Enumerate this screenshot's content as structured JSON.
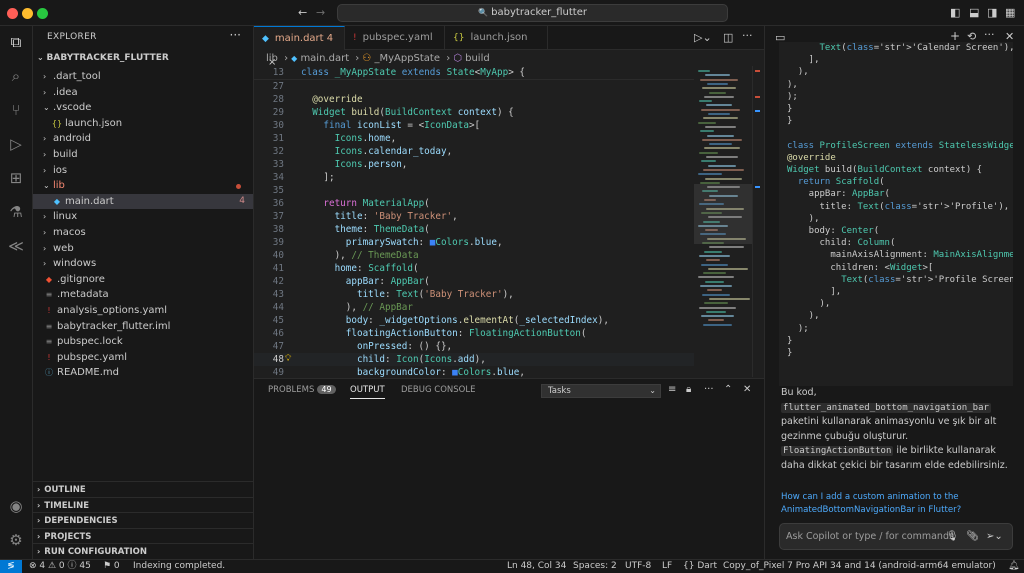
{
  "titlebar": {
    "title": "babytracker_flutter",
    "search_icon": "🔍",
    "back_icon": "←",
    "forward_icon": "→"
  },
  "activity_bar": {
    "items": [
      "files-icon",
      "search-icon",
      "source-control-icon",
      "run-debug-icon",
      "extensions-icon",
      "testing-icon",
      "flutter-icon"
    ],
    "bottom": [
      "account-icon",
      "settings-icon"
    ]
  },
  "explorer": {
    "title": "EXPLORER",
    "project": "BABYTRACKER_FLUTTER",
    "items": [
      {
        "label": ".dart_tool",
        "type": "folder",
        "depth": 0,
        "open": false
      },
      {
        "label": ".idea",
        "type": "folder",
        "depth": 0,
        "open": false
      },
      {
        "label": ".vscode",
        "type": "folder",
        "depth": 0,
        "open": true
      },
      {
        "label": "launch.json",
        "type": "json",
        "depth": 1
      },
      {
        "label": "android",
        "type": "folder",
        "depth": 0,
        "open": false
      },
      {
        "label": "build",
        "type": "folder",
        "depth": 0,
        "open": false
      },
      {
        "label": "ios",
        "type": "folder",
        "depth": 0,
        "open": false
      },
      {
        "label": "lib",
        "type": "folder",
        "depth": 0,
        "open": true,
        "error": true
      },
      {
        "label": "main.dart",
        "type": "dart",
        "depth": 1,
        "selected": true,
        "badge": "4"
      },
      {
        "label": "linux",
        "type": "folder",
        "depth": 0,
        "open": false
      },
      {
        "label": "macos",
        "type": "folder",
        "depth": 0,
        "open": false
      },
      {
        "label": "web",
        "type": "folder",
        "depth": 0,
        "open": false
      },
      {
        "label": "windows",
        "type": "folder",
        "depth": 0,
        "open": false
      },
      {
        "label": ".gitignore",
        "type": "git",
        "depth": 0
      },
      {
        "label": ".metadata",
        "type": "meta",
        "depth": 0
      },
      {
        "label": "analysis_options.yaml",
        "type": "yaml",
        "depth": 0
      },
      {
        "label": "babytracker_flutter.iml",
        "type": "iml",
        "depth": 0
      },
      {
        "label": "pubspec.lock",
        "type": "lock",
        "depth": 0
      },
      {
        "label": "pubspec.yaml",
        "type": "yaml",
        "depth": 0
      },
      {
        "label": "README.md",
        "type": "md",
        "depth": 0
      }
    ],
    "sections": [
      "OUTLINE",
      "TIMELINE",
      "DEPENDENCIES",
      "PROJECTS",
      "RUN CONFIGURATION"
    ]
  },
  "tabs": [
    {
      "label": "main.dart 4",
      "icon": "◆",
      "active": true,
      "close": "×"
    },
    {
      "label": "pubspec.yaml",
      "icon": "!",
      "active": false
    },
    {
      "label": "launch.json",
      "icon": "{}",
      "active": false
    }
  ],
  "breadcrumb": [
    "lib",
    "main.dart",
    "_MyAppState",
    "build"
  ],
  "sticky": {
    "line": "13",
    "text": "class _MyAppState extends State<MyApp> {"
  },
  "code_lines": [
    {
      "n": "27",
      "html": ""
    },
    {
      "n": "28",
      "html": "  <span class='fn'>@override</span>"
    },
    {
      "n": "29",
      "html": "  <span class='ty'>Widget</span> <span class='fn'>build</span>(<span class='ty'>BuildContext</span> <span class='pm'>context</span>) {"
    },
    {
      "n": "30",
      "html": "    <span class='kw'>final</span> <span class='pm'>iconList</span> = &lt;<span class='ty'>IconData</span>&gt;["
    },
    {
      "n": "31",
      "html": "      <span class='ty'>Icons</span>.<span class='pm'>home</span>,"
    },
    {
      "n": "32",
      "html": "      <span class='ty'>Icons</span>.<span class='pm'>calendar_today</span>,"
    },
    {
      "n": "33",
      "html": "      <span class='ty'>Icons</span>.<span class='pm'>person</span>,"
    },
    {
      "n": "34",
      "html": "    ];"
    },
    {
      "n": "35",
      "html": ""
    },
    {
      "n": "36",
      "html": "    <span class='pu'>return</span> <span class='ty'>MaterialApp</span>("
    },
    {
      "n": "37",
      "html": "      <span class='pm'>title</span>: <span class='str'>'Baby Tracker'</span>,"
    },
    {
      "n": "38",
      "html": "      <span class='pm'>theme</span>: <span class='ty'>ThemeData</span>("
    },
    {
      "n": "39",
      "html": "        <span class='pm'>primarySwatch</span>: <span style='color:#3b82f6'>■</span><span class='ty'>Colors</span>.<span class='pm'>blue</span>,"
    },
    {
      "n": "40",
      "html": "      ), <span class='cm'>// ThemeData</span>"
    },
    {
      "n": "41",
      "html": "      <span class='pm'>home</span>: <span class='ty'>Scaffold</span>("
    },
    {
      "n": "42",
      "html": "        <span class='pm'>appBar</span>: <span class='ty'>AppBar</span>("
    },
    {
      "n": "43",
      "html": "          <span class='pm'>title</span>: <span class='ty'>Text</span>(<span class='str'>'Baby Tracker'</span>),"
    },
    {
      "n": "44",
      "html": "        ), <span class='cm'>// AppBar</span>"
    },
    {
      "n": "45",
      "html": "        <span class='pm'>body</span>: <span class='pm'>_widgetOptions</span>.<span class='fn'>elementAt</span>(<span class='pm'>_selectedIndex</span>),"
    },
    {
      "n": "46",
      "html": "        <span class='pm'>floatingActionButton</span>: <span class='ty'>FloatingActionButton</span>("
    },
    {
      "n": "47",
      "html": "          <span class='pm'>onPressed</span>: () {},"
    },
    {
      "n": "48",
      "html": "          <span class='pm'>child</span>: <span class='ty'>Icon</span>(<span class='ty'>Icons</span>.<span class='pm'>add</span>),",
      "current": true
    },
    {
      "n": "49",
      "html": "          <span class='pm'>backgroundColor</span>: <span style='color:#3b82f6'>■</span><span class='ty'>Colors</span>.<span class='pm'>blue</span>,"
    }
  ],
  "panel": {
    "tabs": [
      {
        "label": "PROBLEMS",
        "badge": "49"
      },
      {
        "label": "OUTPUT",
        "active": true
      },
      {
        "label": "DEBUG CONSOLE"
      }
    ],
    "select": "Tasks"
  },
  "chat": {
    "code_lines": [
      "      Text('Calendar Screen'),",
      "    ],",
      "  ),",
      "),",
      ");",
      "}",
      "}",
      "",
      "class ProfileScreen extends StatelessWidget",
      "@override",
      "Widget build(BuildContext context) {",
      "  return Scaffold(",
      "    appBar: AppBar(",
      "      title: Text('Profile'),",
      "    ),",
      "    body: Center(",
      "      child: Column(",
      "        mainAxisAlignment: MainAxisAlignme",
      "        children: <Widget>[",
      "          Text('Profile Screen'),",
      "        ],",
      "      ),",
      "    ),",
      "  );",
      "}",
      "}"
    ],
    "text_1": "Bu kod,",
    "code_1": "flutter_animated_bottom_navigation_bar",
    "text_2": "paketini kullanarak animasyonlu ve şık bir alt gezinme çubuğu oluşturur.",
    "code_2": "FloatingActionButton",
    "text_3": "ile birlikte kullanarak daha dikkat çekici bir tasarım elde edebilirsiniz.",
    "suggestion": "How can I add a custom animation to the AnimatedBottomNavigationBar in Flutter?",
    "input_placeholder": "Ask Copilot or type / for commands"
  },
  "status": {
    "problems": "⊗ 4 ⚠ 0 ⓘ 45",
    "ports": "⚑ 0",
    "indexing": "Indexing completed.",
    "position": "Ln 48, Col 34",
    "spaces": "Spaces: 2",
    "encoding": "UTF-8",
    "eol": "LF",
    "language": "{} Dart",
    "device": "Copy_of_Pixel 7 Pro API 34 and 14 (android-arm64 emulator)"
  }
}
